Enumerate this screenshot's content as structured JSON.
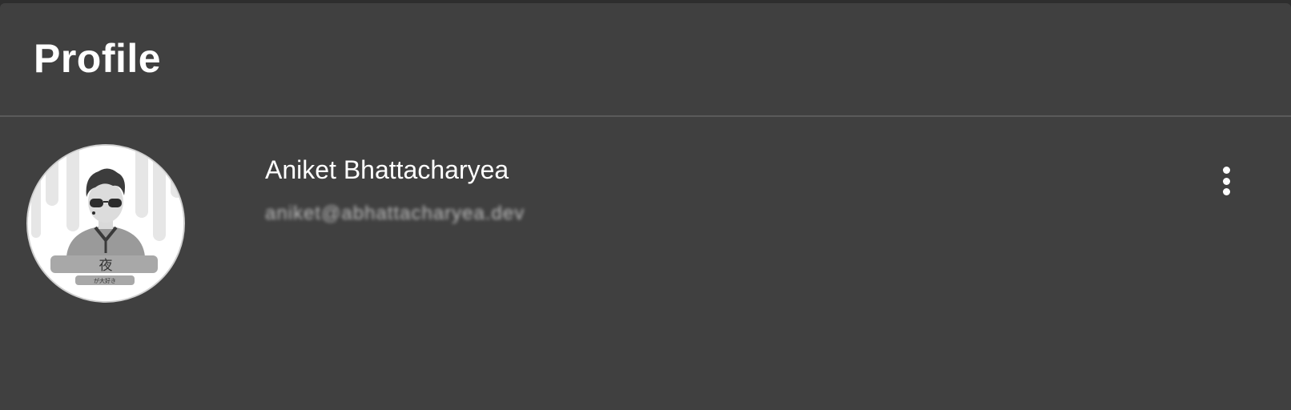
{
  "header": {
    "title": "Profile"
  },
  "profile": {
    "name": "Aniket Bhattacharyea",
    "email": "aniket@abhattacharyea.dev",
    "avatar": {
      "main_glyph": "夜",
      "sub_text": "が大好き"
    }
  },
  "menu": {
    "icon": "more-vertical-icon"
  },
  "colors": {
    "background": "#404040",
    "title": "#ffffff",
    "email": "#bdbdbd",
    "divider": "#5a5a5a"
  }
}
